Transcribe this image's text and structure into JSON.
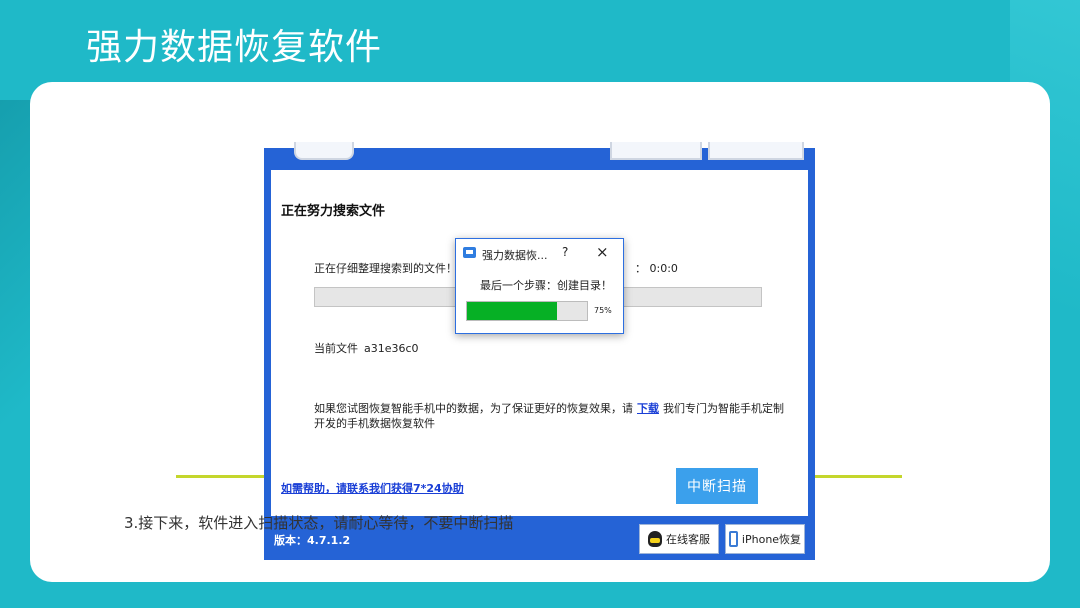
{
  "slide": {
    "title": "强力数据恢复软件",
    "caption": "3.接下来，软件进入扫描状态，请耐心等待，不要中断扫描"
  },
  "app": {
    "status_title": "正在努力搜索文件",
    "searching_label": "正在仔细整理搜索到的文件！(99",
    "elapsed_time": "： 0:0:0",
    "current_file_label": "当前文件",
    "current_file_value": "a31e36c0",
    "notice_prefix": "如果您试图恢复智能手机中的数据，为了保证更好的恢复效果，请",
    "notice_link": "下载",
    "notice_suffix": "我们专门为智能手机定制开发的手机数据恢复软件",
    "help_link": "如需帮助，请联系我们获得7*24协助",
    "stop_button": "中断扫描",
    "version": "版本：4.7.1.2",
    "footer_qq": "在线客服",
    "footer_iphone": "iPhone恢复"
  },
  "dialog": {
    "title": "强力数据恢...",
    "help": "?",
    "close": "×",
    "step": "最后一个步骤：创建目录！",
    "progress": 0.75,
    "percent": "75%"
  },
  "colors": {
    "background": "#1fb9c8",
    "app_blue": "#2563d6",
    "progress_green": "#06b025",
    "accent_line": "#c4d62c",
    "link": "#1a3fd6"
  },
  "icons": [
    "app-logo-icon",
    "qq-icon",
    "phone-icon",
    "close-icon",
    "help-icon"
  ]
}
